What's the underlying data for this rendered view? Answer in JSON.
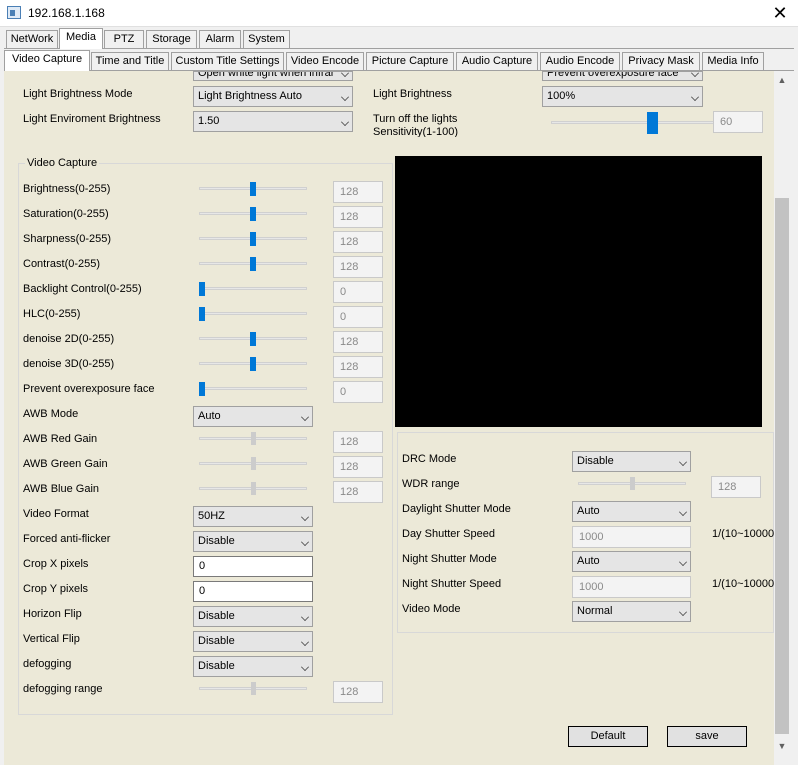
{
  "window": {
    "title": "192.168.1.168",
    "close_glyph": "✕"
  },
  "main_tabs": [
    "NetWork",
    "Media",
    "PTZ",
    "Storage",
    "Alarm",
    "System"
  ],
  "sub_tabs": [
    "Video Capture",
    "Time and Title",
    "Custom Title Settings",
    "Video Encode",
    "Picture Capture",
    "Audio Capture",
    "Audio Encode",
    "Privacy Mask",
    "Media Info"
  ],
  "top": {
    "left_cut_combo": "Open white light when infrar",
    "right_cut_combo": "Prevent overexposure face",
    "light_brightness_mode_label": "Light Brightness Mode",
    "light_brightness_mode_value": "Light Brightness Auto",
    "light_brightness_label": "Light Brightness",
    "light_brightness_value": "100%",
    "light_env_brightness_label": "Light Enviroment Brightness",
    "light_env_brightness_value": "1.50",
    "turn_off_label_1": "Turn off the lights",
    "turn_off_label_2": "Sensitivity(1-100)",
    "turn_off_value": "60",
    "turn_off_fraction": 0.6
  },
  "video_capture": {
    "title": "Video Capture",
    "sliders": [
      {
        "label": "Brightness(0-255)",
        "value": "128",
        "fraction": 0.5,
        "enabled": true
      },
      {
        "label": "Saturation(0-255)",
        "value": "128",
        "fraction": 0.5,
        "enabled": true
      },
      {
        "label": "Sharpness(0-255)",
        "value": "128",
        "fraction": 0.5,
        "enabled": true
      },
      {
        "label": "Contrast(0-255)",
        "value": "128",
        "fraction": 0.5,
        "enabled": true
      },
      {
        "label": "Backlight Control(0-255)",
        "value": "0",
        "fraction": 0.0,
        "enabled": true
      },
      {
        "label": "HLC(0-255)",
        "value": "0",
        "fraction": 0.0,
        "enabled": true
      },
      {
        "label": "denoise 2D(0-255)",
        "value": "128",
        "fraction": 0.5,
        "enabled": true
      },
      {
        "label": "denoise 3D(0-255)",
        "value": "128",
        "fraction": 0.5,
        "enabled": true
      },
      {
        "label": "Prevent overexposure face",
        "value": "0",
        "fraction": 0.0,
        "enabled": true
      }
    ],
    "awb_mode_label": "AWB Mode",
    "awb_mode_value": "Auto",
    "gains": [
      {
        "label": "AWB Red Gain",
        "value": "128",
        "fraction": 0.5,
        "enabled": false
      },
      {
        "label": "AWB Green Gain",
        "value": "128",
        "fraction": 0.5,
        "enabled": false
      },
      {
        "label": "AWB Blue Gain",
        "value": "128",
        "fraction": 0.5,
        "enabled": false
      }
    ],
    "video_format_label": "Video Format",
    "video_format_value": "50HZ",
    "anti_flicker_label": "Forced anti-flicker",
    "anti_flicker_value": "Disable",
    "crop_x_label": "Crop X pixels",
    "crop_x_value": "0",
    "crop_y_label": "Crop Y pixels",
    "crop_y_value": "0",
    "horizon_flip_label": "Horizon Flip",
    "horizon_flip_value": "Disable",
    "vertical_flip_label": "Vertical Flip",
    "vertical_flip_value": "Disable",
    "defogging_label": "defogging",
    "defogging_value": "Disable",
    "defogging_range_label": "defogging range",
    "defogging_range_value": "128",
    "defogging_range_fraction": 0.5
  },
  "right": {
    "drc_mode_label": "DRC Mode",
    "drc_mode_value": "Disable",
    "wdr_range_label": "WDR range",
    "wdr_range_value": "128",
    "wdr_range_fraction": 0.5,
    "daylight_shutter_mode_label": "Daylight Shutter Mode",
    "daylight_shutter_mode_value": "Auto",
    "day_shutter_speed_label": "Day Shutter Speed",
    "day_shutter_speed_value": "1000",
    "day_shutter_unit": "1/(10~10000",
    "night_shutter_mode_label": "Night Shutter Mode",
    "night_shutter_mode_value": "Auto",
    "night_shutter_speed_label": "Night Shutter Speed",
    "night_shutter_speed_value": "1000",
    "night_shutter_unit": "1/(10~10000",
    "video_mode_label": "Video Mode",
    "video_mode_value": "Normal"
  },
  "buttons": {
    "default": "Default",
    "save": "save"
  },
  "colors": {
    "accent": "#0078d7",
    "panel": "#ece9d8",
    "preview": "#000000"
  }
}
